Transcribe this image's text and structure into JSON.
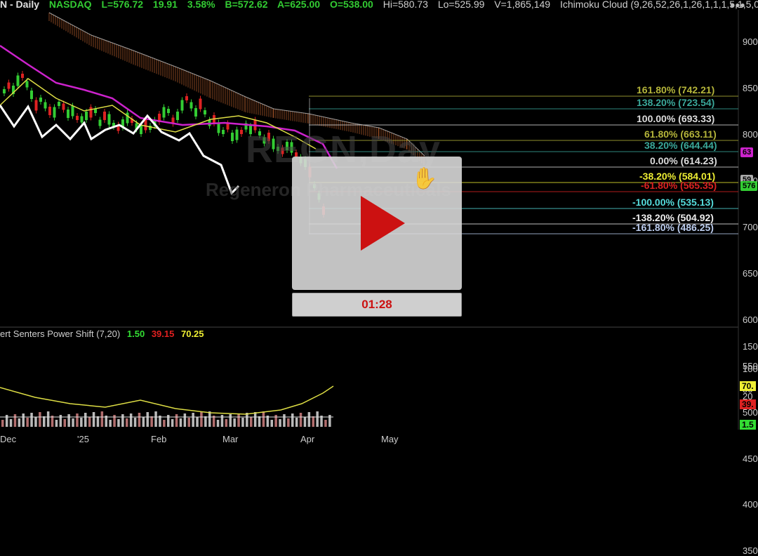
{
  "header": {
    "symbol_desc": "N - Daily",
    "exchange": "NASDAQ",
    "last": "L=576.72",
    "change": "19.91",
    "change_pct": "3.58%",
    "bid": "B=572.62",
    "ask": "A=625.00",
    "open": "O=538.00",
    "high": "Hi=580.73",
    "low": "Lo=525.99",
    "volume": "V=1,865,149",
    "study": "Ichimoku Cloud (9,26,52,26,1,26,1,1,1,5,1,5,0",
    "menu_icon": "more-dots-icon"
  },
  "watermark": {
    "ticker": "REGN,Day",
    "company": "Regeneron Pharmaceuticals"
  },
  "price_axis": [
    "900",
    "850",
    "800",
    "750",
    "700",
    "650",
    "600",
    "550",
    "500",
    "450",
    "400",
    "350"
  ],
  "price_tags": [
    {
      "text": "63",
      "color": "#cc22cc"
    },
    {
      "text": "59",
      "color": "#aaaaaa"
    },
    {
      "text": "576",
      "color": "#33cc33"
    }
  ],
  "fib_levels": [
    {
      "label": "161.80% (742.21)",
      "color": "#b5b53a"
    },
    {
      "label": "138.20% (723.54)",
      "color": "#3aa89a"
    },
    {
      "label": "100.00% (693.33)",
      "color": "#dddddd"
    },
    {
      "label": "61.80% (663.11)",
      "color": "#b5b53a"
    },
    {
      "label": "38.20% (644.44)",
      "color": "#3aa89a"
    },
    {
      "label": "0.00% (614.23)",
      "color": "#dddddd"
    },
    {
      "label": "-38.20% (584.01)",
      "color": "#eeee33"
    },
    {
      "label": "-61.80% (565.35)",
      "color": "#dd2222"
    },
    {
      "label": "-100.00% (535.13)",
      "color": "#55dddd"
    },
    {
      "label": "-138.20% (504.92)",
      "color": "#eeeeee"
    },
    {
      "label": "-161.80% (486.25)",
      "color": "#bbccee"
    }
  ],
  "indicator": {
    "name": "ert Senters Power Shift (7,20)",
    "v1": "1.50",
    "v2": "39.15",
    "v3": "70.25",
    "axis": [
      "150",
      "100",
      "50",
      "20"
    ],
    "tags": [
      {
        "text": "70.",
        "color": "#eeee33"
      },
      {
        "text": "39.",
        "color": "#dd2222"
      },
      {
        "text": "1.5",
        "color": "#33dd33"
      }
    ]
  },
  "time_axis": [
    "Dec",
    "'25",
    "Feb",
    "Mar",
    "Apr",
    "May"
  ],
  "video": {
    "duration": "01:28",
    "play_icon": "play-icon",
    "cursor_icon": "hand-cursor-icon"
  },
  "colors": {
    "ichimoku_cloud": "#b05a2a",
    "tenkan": "#dddd44",
    "kijun": "#cc22cc",
    "lagging": "#ffffff",
    "up_candle": "#33cc33",
    "down_candle": "#dd2222"
  }
}
